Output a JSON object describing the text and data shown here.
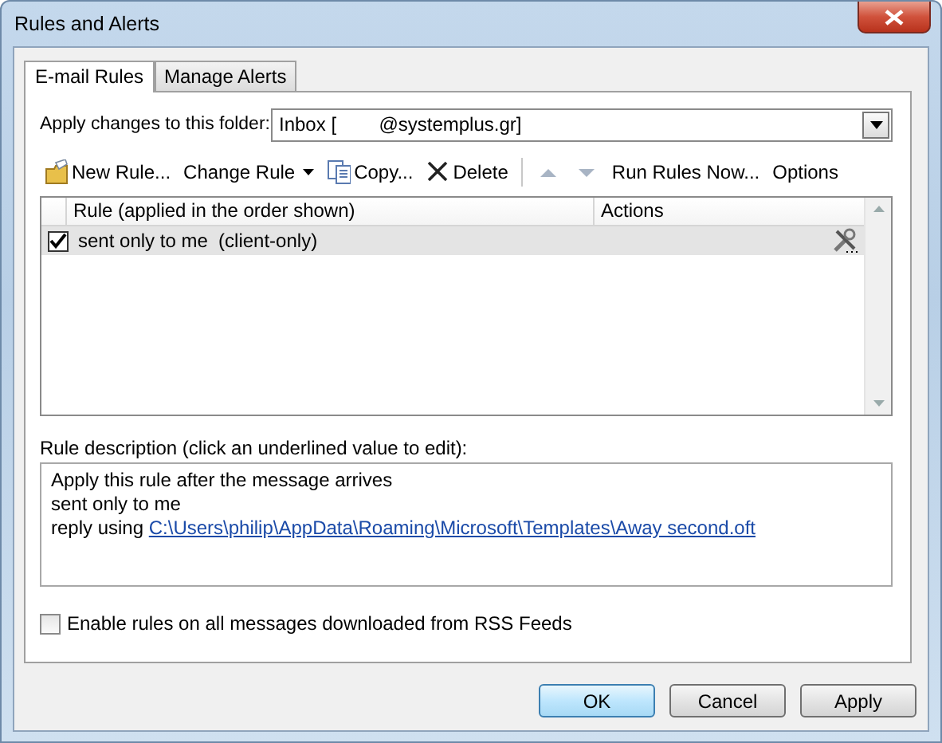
{
  "window": {
    "title": "Rules and Alerts"
  },
  "tabs": [
    {
      "label": "E-mail Rules",
      "selected": true
    },
    {
      "label": "Manage Alerts",
      "selected": false
    }
  ],
  "folder": {
    "label": "Apply changes to this folder:",
    "value": "Inbox [        @systemplus.gr]"
  },
  "toolbar": [
    {
      "kind": "icon-button",
      "label": "New Rule..."
    },
    {
      "kind": "menu",
      "label": "Change Rule"
    },
    {
      "kind": "icon-button",
      "label": "Copy..."
    },
    {
      "kind": "icon-button",
      "label": "Delete"
    },
    {
      "kind": "separator"
    },
    {
      "kind": "arrow-up",
      "disabled": true
    },
    {
      "kind": "arrow-down",
      "disabled": true
    },
    {
      "kind": "button",
      "label": "Run Rules Now..."
    },
    {
      "kind": "button",
      "label": "Options"
    }
  ],
  "rules": {
    "columns": [
      "Rule (applied in the order shown)",
      "Actions"
    ],
    "rows": [
      {
        "name": "sent only to me  (client-only)",
        "checked": true,
        "selected": true
      }
    ]
  },
  "description": {
    "label": "Rule description (click an underlined value to edit):",
    "lines": [
      {
        "text": "Apply this rule after the message arrives"
      },
      {
        "text": "sent only to me"
      },
      {
        "text": "reply using ",
        "link": "C:\\Users\\philip\\AppData\\Roaming\\Microsoft\\Templates\\Away second.oft"
      }
    ]
  },
  "rss": {
    "label": "Enable rules on all messages downloaded from RSS Feeds",
    "checked": false
  },
  "buttons": [
    {
      "label": "OK",
      "default": true
    },
    {
      "label": "Cancel",
      "default": false
    },
    {
      "label": "Apply",
      "default": false
    }
  ]
}
